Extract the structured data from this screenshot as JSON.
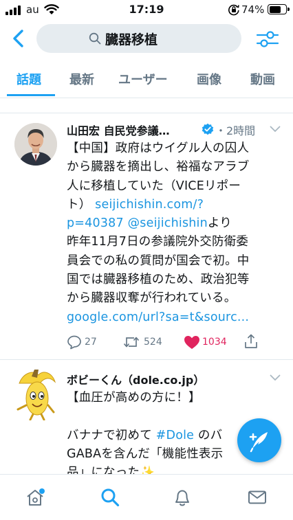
{
  "status_bar": {
    "carrier": "au",
    "time": "17:19",
    "battery": "74%",
    "battery_level": 0.74
  },
  "search": {
    "query": "臓器移植"
  },
  "tabs": [
    {
      "label": "話題",
      "active": true
    },
    {
      "label": "最新",
      "active": false
    },
    {
      "label": "ユーザー",
      "active": false
    },
    {
      "label": "画像",
      "active": false
    },
    {
      "label": "動画",
      "active": false
    }
  ],
  "tweets": [
    {
      "author": "山田宏 自民党参議…",
      "verified": true,
      "time": "・2時間",
      "lines": [
        [
          {
            "t": "【中国】政府はウイグル人の囚人"
          }
        ],
        [
          {
            "t": "から臓器を摘出し、裕福なアラブ"
          }
        ],
        [
          {
            "t": "人に移植していた（VICEリポー"
          }
        ],
        [
          {
            "t": "ト） "
          },
          {
            "t": "seijichishin.com/?",
            "link": true
          }
        ],
        [
          {
            "t": "p=40387 @seijichishin",
            "link": true
          },
          {
            "t": "より"
          }
        ],
        [
          {
            "t": "昨年11月7日の参議院外交防衛委"
          }
        ],
        [
          {
            "t": "員会での私の質問が国会で初。中"
          }
        ],
        [
          {
            "t": "国では臓器移植のため、政治犯等"
          }
        ],
        [
          {
            "t": "から臓器収奪が行われている。"
          }
        ],
        [
          {
            "t": "google.com/url?sa=t&sourc...",
            "link": true
          }
        ]
      ],
      "replies": "27",
      "retweets": "524",
      "likes": "1034",
      "liked": true
    },
    {
      "author": "ボビーくん（dole.co.jp）",
      "verified": false,
      "lines": [
        [
          {
            "t": "【血圧が高めの方に！】"
          }
        ],
        [
          {
            "t": ""
          }
        ],
        [
          {
            "t": "バナナで初めて "
          },
          {
            "t": "#Dole",
            "link": true
          },
          {
            "t": " のバ"
          }
        ],
        [
          {
            "t": "GABAを含んだ「機能性表示"
          }
        ],
        [
          {
            "t": "品」になった✨"
          }
        ]
      ]
    }
  ],
  "icons": {
    "back": "back-chevron-icon",
    "search": "search-icon",
    "filter": "filter-sliders-icon",
    "compose": "compose-tweet-icon",
    "nav": [
      "home-icon",
      "search-icon",
      "notifications-bell-icon",
      "messages-envelope-icon"
    ]
  },
  "colors": {
    "accent": "#1da1f2",
    "link": "#1b95e0",
    "like": "#e0245e",
    "muted": "#657786"
  }
}
